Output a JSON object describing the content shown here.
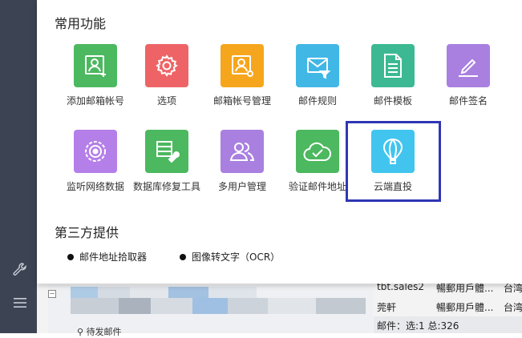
{
  "sections": {
    "common_title": "常用功能",
    "third_title": "第三方提供"
  },
  "tiles": [
    {
      "label": "添加邮箱帐号",
      "icon": "add-mailbox-icon",
      "color": "#4cb85f"
    },
    {
      "label": "选项",
      "icon": "gear-icon",
      "color": "#ee6466"
    },
    {
      "label": "邮箱帐号管理",
      "icon": "account-settings-icon",
      "color": "#f6a61c"
    },
    {
      "label": "邮件规则",
      "icon": "mail-filter-icon",
      "color": "#41b7e6"
    },
    {
      "label": "邮件模板",
      "icon": "document-icon",
      "color": "#3cb993"
    },
    {
      "label": "邮件签名",
      "icon": "pen-icon",
      "color": "#a97fe0"
    },
    {
      "label": "监听网络数据",
      "icon": "target-icon",
      "color": "#b47fe8"
    },
    {
      "label": "数据库修复工具",
      "icon": "database-repair-icon",
      "color": "#4cb85f"
    },
    {
      "label": "多用户管理",
      "icon": "users-icon",
      "color": "#a97fe0"
    },
    {
      "label": "验证邮件地址",
      "icon": "cloud-check-icon",
      "color": "#4cb85f"
    },
    {
      "label": "云端直投",
      "icon": "balloon-icon",
      "color": "#41c5ee"
    }
  ],
  "third_party": [
    {
      "label": "邮件地址拾取器"
    },
    {
      "label": "图像转文字（OCR）"
    }
  ],
  "background": {
    "rows": [
      {
        "c1": "tbt.sales2",
        "c2": "暢郵用戶體...",
        "c3": "台湾"
      },
      {
        "c1": "莞軒",
        "c2": "暢郵用戶體...",
        "c3": "台湾"
      }
    ],
    "status": "邮件：选:1 总:326",
    "tree_node": "待发邮件"
  }
}
